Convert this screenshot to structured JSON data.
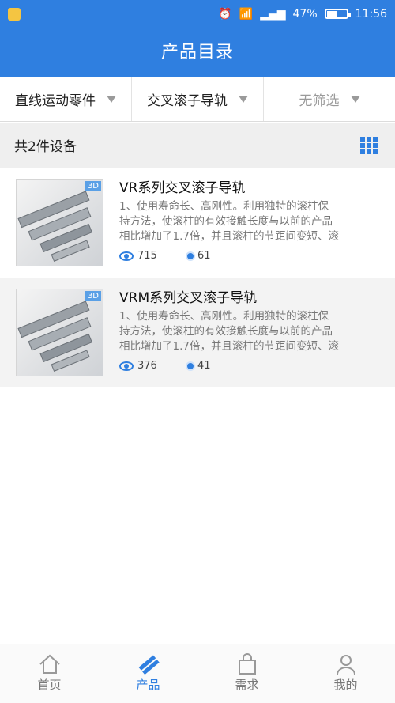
{
  "status": {
    "battery": "47%",
    "battery_level": 0.47,
    "time": "11:56"
  },
  "header": {
    "title": "产品目录"
  },
  "filters": [
    {
      "label": "直线运动零件"
    },
    {
      "label": "交叉滚子导轨"
    },
    {
      "label": "无筛选"
    }
  ],
  "summary": {
    "count_text": "共2件设备"
  },
  "products": [
    {
      "name": "VR系列交叉滚子导轨",
      "desc_lines": [
        "1、使用寿命长、高刚性。利用独特的滚柱保",
        "持方法，使滚柱的有效接触长度与以前的产品",
        "相比增加了1.7倍，并且滚柱的节距间变短、滚"
      ],
      "views": "715",
      "likes": "61",
      "badge": "3D"
    },
    {
      "name": "VRM系列交叉滚子导轨",
      "desc_lines": [
        "1、使用寿命长、高刚性。利用独特的滚柱保",
        "持方法，使滚柱的有效接触长度与以前的产品",
        "相比增加了1.7倍，并且滚柱的节距间变短、滚"
      ],
      "views": "376",
      "likes": "41",
      "badge": "3D"
    }
  ],
  "tabs": [
    {
      "label": "首页",
      "icon": "home-icon"
    },
    {
      "label": "产品",
      "icon": "product-icon",
      "active": true
    },
    {
      "label": "需求",
      "icon": "bag-icon"
    },
    {
      "label": "我的",
      "icon": "user-icon"
    }
  ],
  "colors": {
    "accent": "#2f7fe0"
  }
}
